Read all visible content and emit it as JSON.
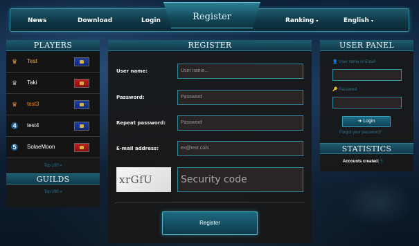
{
  "nav": {
    "items": [
      {
        "label": "News",
        "has_caret": false
      },
      {
        "label": "Download",
        "has_caret": false
      },
      {
        "label": "Login",
        "has_caret": false
      },
      {
        "label": "Ranking",
        "has_caret": true
      },
      {
        "label": "English",
        "has_caret": true
      }
    ],
    "center_label": "Register"
  },
  "players": {
    "title": "PLAYERS",
    "rows": [
      {
        "rank_icon": "gold-crown-icon",
        "name": "Test",
        "flag": "blue-flag-icon"
      },
      {
        "rank_icon": "silver-crown-icon",
        "name": "Taki",
        "flag": "red-flag-icon"
      },
      {
        "rank_icon": "bronze-crown-icon",
        "name": "test3",
        "flag": "blue-flag-icon"
      },
      {
        "rank_num": "4",
        "name": "test4",
        "flag": "blue-flag-icon"
      },
      {
        "rank_num": "5",
        "name": "SolaeMoon",
        "flag": "red-flag-icon"
      }
    ],
    "top_link": "Top 100 »"
  },
  "guilds": {
    "title": "GUILDS",
    "top_link": "Top 100 »"
  },
  "register": {
    "title": "REGISTER",
    "fields": [
      {
        "label": "User name:",
        "placeholder": "User name..."
      },
      {
        "label": "Password:",
        "placeholder": "Password"
      },
      {
        "label": "Repeat password:",
        "placeholder": "Password"
      },
      {
        "label": "E-mail address:",
        "placeholder": "ex@test.com"
      }
    ],
    "captcha_text": "xrGfU",
    "captcha_placeholder": "Security code",
    "submit_label": "Register"
  },
  "user_panel": {
    "title": "USER PANEL",
    "username_label": "User name or Email",
    "password_label": "Password",
    "login_label": "Login",
    "forgot_label": "Forgot your password?"
  },
  "statistics": {
    "title": "STATISTICS",
    "accounts_label": "Accounts created:",
    "accounts_value": "5"
  },
  "colors": {
    "accent": "#2f8ca3",
    "link": "#2d7791",
    "gold_name": "#e6b45a",
    "orange_name": "#f08a2a"
  }
}
